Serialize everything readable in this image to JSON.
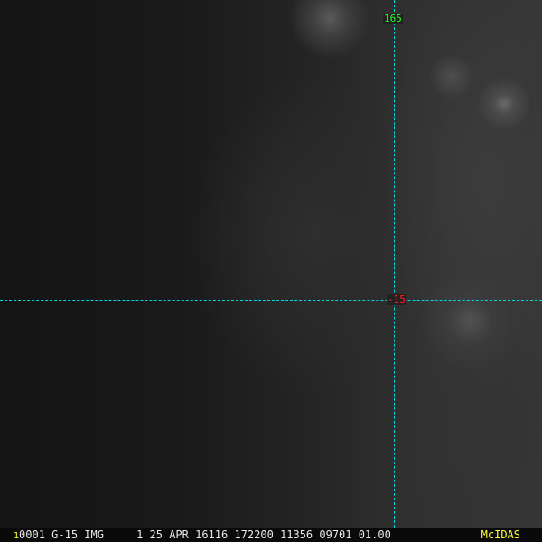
{
  "grid": {
    "longitude_label": "165",
    "latitude_label": "-15"
  },
  "footer": {
    "frame_number": "1",
    "info": "0001 G-15 IMG     1 25 APR 16116 172200 11356 09701 01.00",
    "logo": "McIDAS"
  },
  "colors": {
    "grid_line": "#00d8e0",
    "lon_label": "#20ff20",
    "lat_label": "#ff2020",
    "logo": "#ffff30"
  }
}
